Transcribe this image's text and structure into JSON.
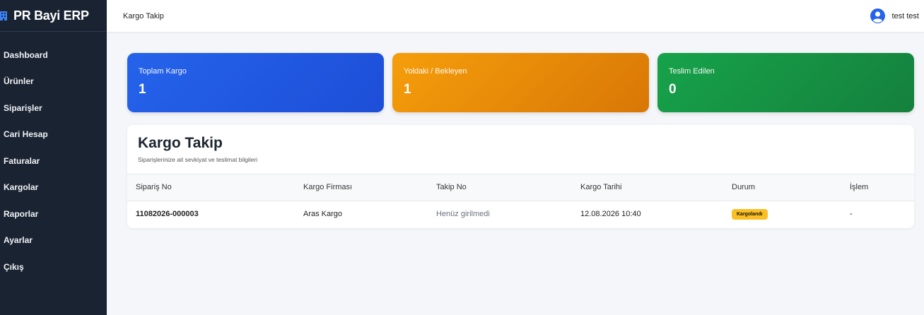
{
  "sidebar": {
    "brand": "PR Bayi ERP",
    "items": [
      {
        "label": "Dashboard"
      },
      {
        "label": "Ürünler"
      },
      {
        "label": "Siparişler"
      },
      {
        "label": "Cari Hesap"
      },
      {
        "label": "Faturalar"
      },
      {
        "label": "Kargolar"
      },
      {
        "label": "Raporlar"
      },
      {
        "label": "Ayarlar"
      },
      {
        "label": "Çıkış"
      }
    ]
  },
  "topbar": {
    "title": "Kargo Takip",
    "user_name": "test test"
  },
  "stats": [
    {
      "label": "Toplam Kargo",
      "value": "1",
      "color": "#2563eb"
    },
    {
      "label": "Yoldaki / Bekleyen",
      "value": "1",
      "color": "#f59e0b"
    },
    {
      "label": "Teslim Edilen",
      "value": "0",
      "color": "#16a34a"
    }
  ],
  "panel": {
    "title": "Kargo Takip",
    "subtitle": "Siparişlerinize ait sevkiyat ve teslimat bilgileri",
    "columns": [
      "Sipariş No",
      "Kargo Firması",
      "Takip No",
      "Kargo Tarihi",
      "Durum",
      "İşlem"
    ],
    "rows": [
      {
        "order_no": "11082026-000003",
        "carrier": "Aras Kargo",
        "tracking_no": "Henüz girilmedi",
        "date": "12.08.2026 10:40",
        "status": "Kargolandı",
        "status_color": "#fbbf24",
        "action": "-"
      }
    ]
  },
  "icons": {
    "brand": "building-icon",
    "user": "user-circle-icon"
  }
}
